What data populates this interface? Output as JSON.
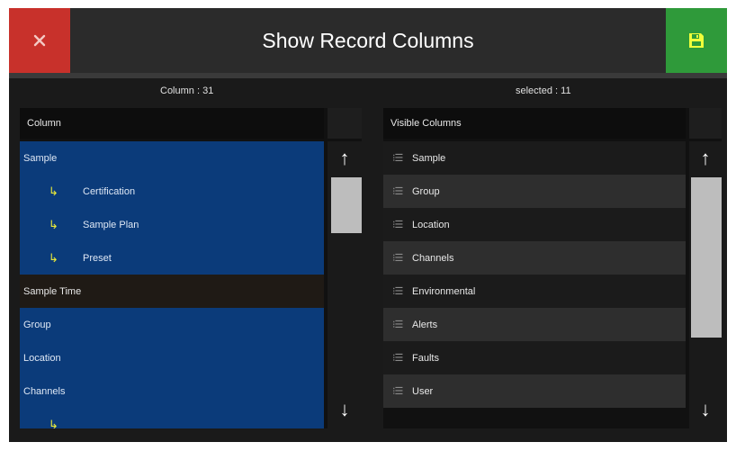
{
  "header": {
    "title": "Show Record Columns",
    "close_icon": "✕",
    "save_icon": "floppy-disk",
    "close_color": "#c8312b",
    "save_color": "#2f9a3a"
  },
  "counts": {
    "column_count": "Column : 31",
    "selected_count": "selected : 11"
  },
  "left_panel": {
    "header": "Column",
    "rows": [
      {
        "label": "Sample",
        "selected": true,
        "child": false
      },
      {
        "label": "Certification",
        "selected": true,
        "child": true
      },
      {
        "label": "Sample Plan",
        "selected": true,
        "child": true
      },
      {
        "label": "Preset",
        "selected": true,
        "child": true
      },
      {
        "label": "Sample Time",
        "selected": false,
        "child": false
      },
      {
        "label": "Group",
        "selected": true,
        "child": false
      },
      {
        "label": "Location",
        "selected": true,
        "child": false
      },
      {
        "label": "Channels",
        "selected": true,
        "child": false
      },
      {
        "label": "",
        "selected": true,
        "child": true
      }
    ],
    "scroll_up_icon": "↑",
    "scroll_down_icon": "↓"
  },
  "right_panel": {
    "header": "Visible Columns",
    "rows": [
      "Sample",
      "Group",
      "Location",
      "Channels",
      "Environmental",
      "Alerts",
      "Faults",
      "User"
    ],
    "scroll_up_icon": "↑",
    "scroll_down_icon": "↓"
  },
  "icons": {
    "child_arrow": "↳",
    "list_icon": "⁝☰"
  }
}
